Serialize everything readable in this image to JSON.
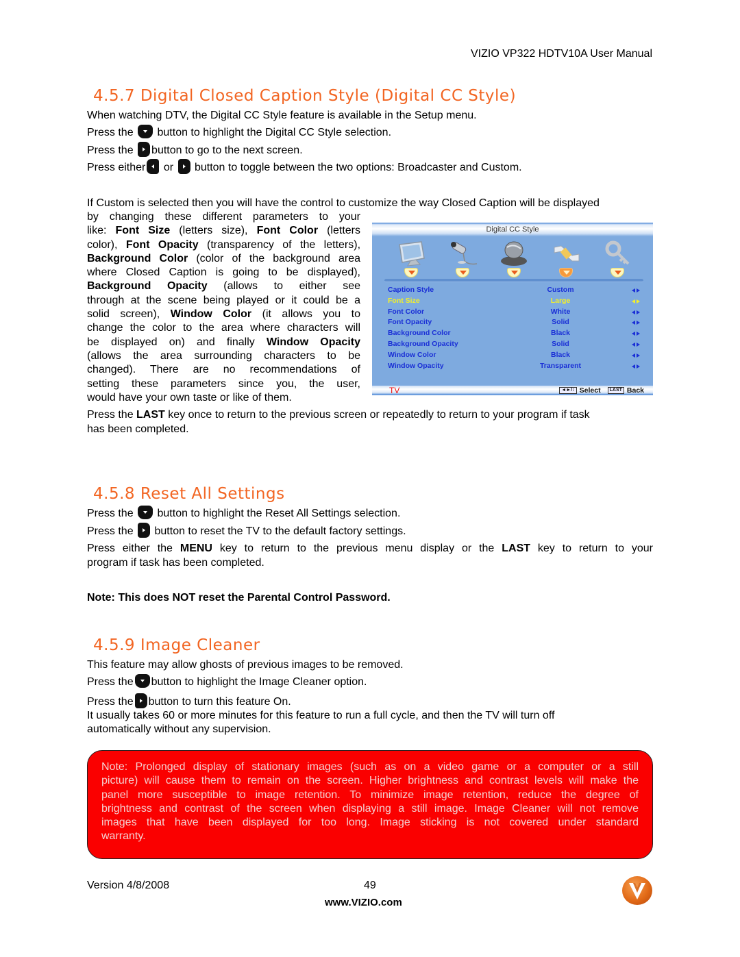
{
  "header": {
    "running_title": "VIZIO VP322 HDTV10A User Manual"
  },
  "section_457": {
    "title": "4.5.7 Digital Closed Caption Style (Digital CC Style)",
    "intro": "When watching DTV, the Digital CC Style feature is available in the Setup menu.",
    "step1_pre": "Press the",
    "step1_post": "button to highlight the Digital CC Style selection.",
    "step2_pre": "Press the",
    "step2_post": "button to go to the next screen.",
    "step3_pre": "Press either",
    "step3_mid": "or",
    "step3_post": "button to toggle between the two options: Broadcaster and Custom.",
    "custom_lines": [
      "If Custom is selected then you will have the control to customize the way Closed Caption will be displayed",
      "by changing these different parameters to your"
    ],
    "desc": {
      "l1_a": "like: ",
      "l1_b": "Font Size",
      "l1_c": " (letters size), ",
      "l1_d": "Font Color",
      "l1_e": " (letters",
      "l2_a": "color), ",
      "l2_b": "Font Opacity",
      "l2_c": " (transparency of the letters),",
      "l3_a": "Background Color",
      "l3_b": " (color of the background area",
      "l4": "where Closed Caption is going to be displayed),",
      "l5_a": "Background Opacity",
      "l5_b": " (allows to either see",
      "l6": "through at the scene being played or it could be a",
      "l7_a": "solid screen), ",
      "l7_b": "Window Color",
      "l7_c": " (it allows you to",
      "l8": "change the color to the area where characters will",
      "l9_a": "be displayed on) and finally ",
      "l9_b": "Window Opacity",
      "l10": "(allows the area surrounding characters to be",
      "l11": "changed). There are no recommendations of",
      "l12": "setting these parameters since you, the user,",
      "l13": "would have your own taste or like of them."
    },
    "last_a": "Press the ",
    "last_b": "LAST",
    "last_c": " key once to return to the previous screen or repeatedly to return to your program if task",
    "last_d": "has been completed."
  },
  "osd": {
    "title": "Digital CC Style",
    "icons": [
      "tv-icon",
      "microphone-icon",
      "satellite-dish-icon",
      "settings-icon",
      "key-icon"
    ],
    "active_tab": 3,
    "rows": [
      {
        "label": "Caption Style",
        "value": "Custom",
        "highlight": false
      },
      {
        "label": "Font Size",
        "value": "Large",
        "highlight": true
      },
      {
        "label": "Font Color",
        "value": "White",
        "highlight": false
      },
      {
        "label": "Font Opacity",
        "value": "Solid",
        "highlight": false
      },
      {
        "label": "Background Color",
        "value": "Black",
        "highlight": false
      },
      {
        "label": "Background Opacity",
        "value": "Solid",
        "highlight": false
      },
      {
        "label": "Window Color",
        "value": "Black",
        "highlight": false
      },
      {
        "label": "Window Opacity",
        "value": "Transparent",
        "highlight": false
      }
    ],
    "footer": {
      "source": "TV",
      "nav_key": "◄►/↕",
      "select_label": "Select",
      "last_key": "LAST",
      "back_label": "Back"
    }
  },
  "section_458": {
    "title": "4.5.8 Reset All Settings",
    "step1_pre": "Press the",
    "step1_post": "button to highlight the Reset All Settings selection.",
    "step2_pre": "Press the",
    "step2_post": "button to reset the TV to the default factory settings.",
    "p_a": "Press either the ",
    "p_b": "MENU",
    "p_c": " key to return to the previous menu display or the ",
    "p_d": "LAST",
    "p_e": " key to return to your",
    "p_f": "program if task has been completed.",
    "note": "Note: This does NOT reset the Parental Control Password."
  },
  "section_459": {
    "title": "4.5.9 Image Cleaner",
    "intro": "This feature may allow ghosts of previous images to be removed.",
    "step1_pre": "Press the",
    "step1_post": "button to highlight the Image Cleaner option.",
    "step2_pre": "Press the",
    "step2_post": "button to turn this feature On.",
    "duration_lines": [
      "It usually takes 60 or more minutes for this feature to run a full cycle, and then the TV will turn off",
      "automatically without any supervision."
    ]
  },
  "warning_note": {
    "lines": [
      "Note: Prolonged display of stationary images (such as on a video game or a computer or a still",
      "picture) will cause them to remain on the screen. Higher brightness and contrast levels will make the",
      "panel more susceptible to image retention. To minimize image retention, reduce the degree of",
      "brightness and contrast of the screen when displaying a still image. Image Cleaner will not remove",
      "images that have been displayed for too long. Image sticking is not covered under standard",
      "warranty."
    ],
    "bg_color": "#fa0000"
  },
  "footer": {
    "version": "Version 4/8/2008",
    "page_number": "49",
    "url": "www.VIZIO.com",
    "logo_letter": "V"
  },
  "colors": {
    "heading": "#f26522",
    "osd_bg": "#7eaadf",
    "osd_text": "#1a2fd6",
    "osd_highlight": "#f4f02a"
  }
}
